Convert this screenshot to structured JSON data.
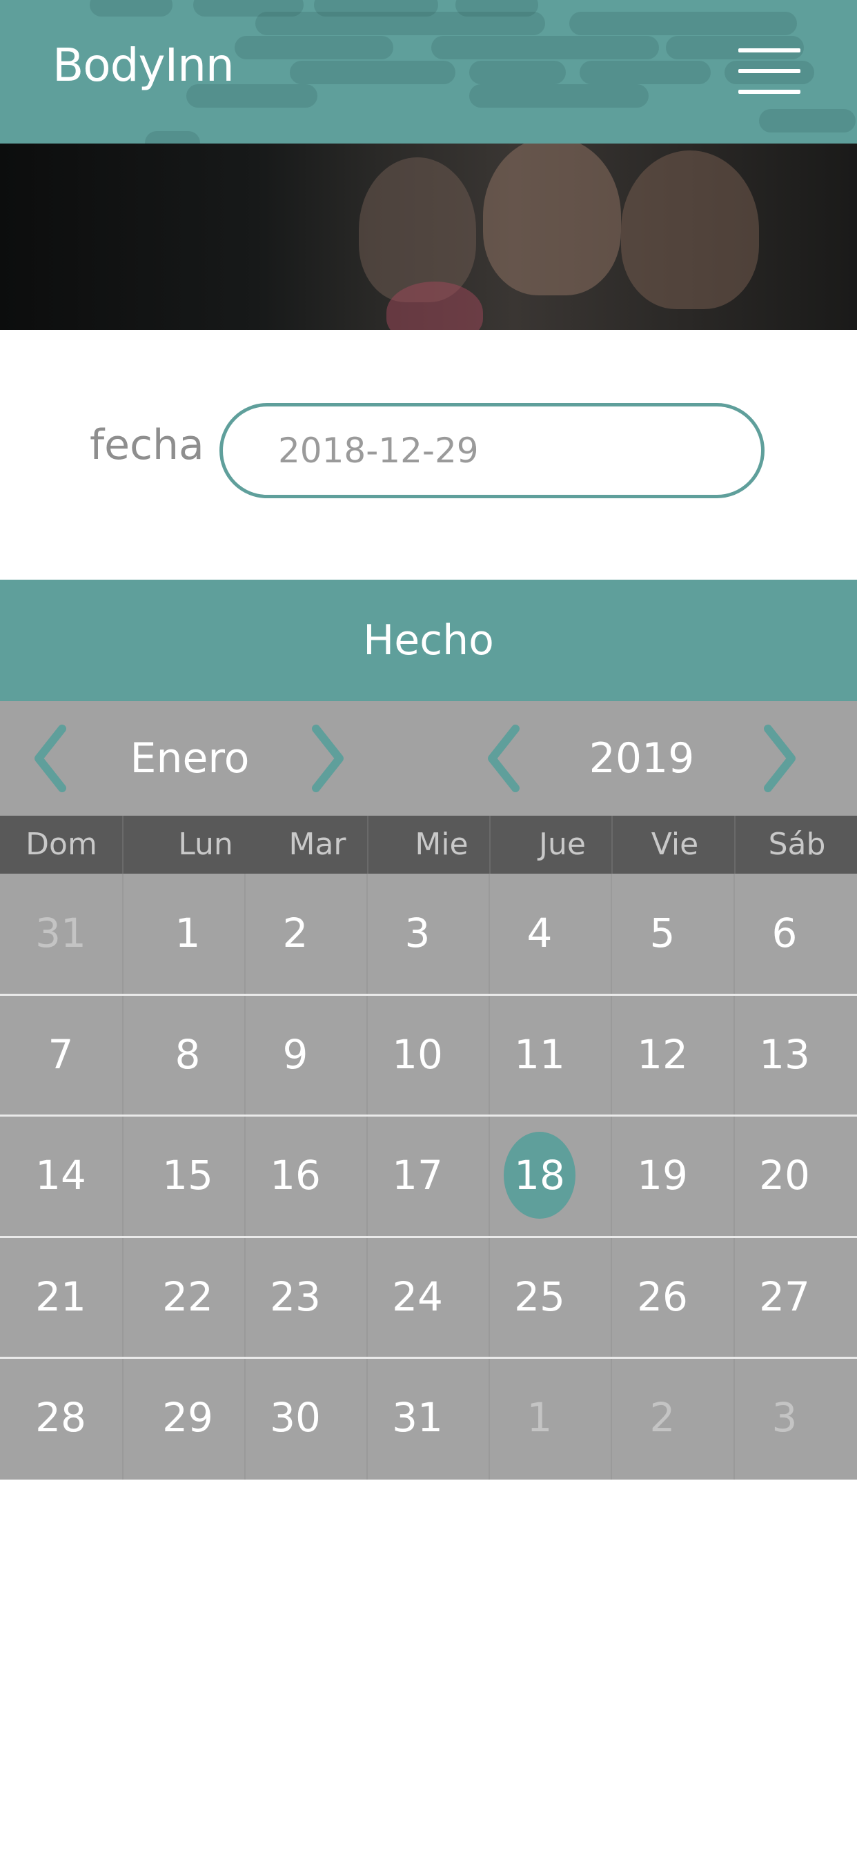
{
  "header": {
    "brand": "BodyInn",
    "menu_icon": "hamburger-menu-icon"
  },
  "hero": {
    "image": "three smiling women after workout photo"
  },
  "form": {
    "label": "fecha",
    "date_value": "2018-12-29"
  },
  "done_button": {
    "label": "Hecho"
  },
  "picker": {
    "month": "Enero",
    "year": "2019",
    "weekdays": [
      "Dom",
      "Lun",
      "Mar",
      "Mie",
      "Jue",
      "Vie",
      "Sáb"
    ],
    "weeks": [
      [
        "31",
        "1",
        "2",
        "3",
        "4",
        "5",
        "6"
      ],
      [
        "7",
        "8",
        "9",
        "10",
        "11",
        "12",
        "13"
      ],
      [
        "14",
        "15",
        "16",
        "17",
        "18",
        "19",
        "20"
      ],
      [
        "21",
        "22",
        "23",
        "24",
        "25",
        "26",
        "27"
      ],
      [
        "28",
        "29",
        "30",
        "31",
        "1",
        "2",
        "3"
      ]
    ],
    "selected_day": "18"
  },
  "colors": {
    "accent": "#5f9f9b",
    "grid": "#a3a3a3",
    "weekday_bar": "#595959"
  }
}
